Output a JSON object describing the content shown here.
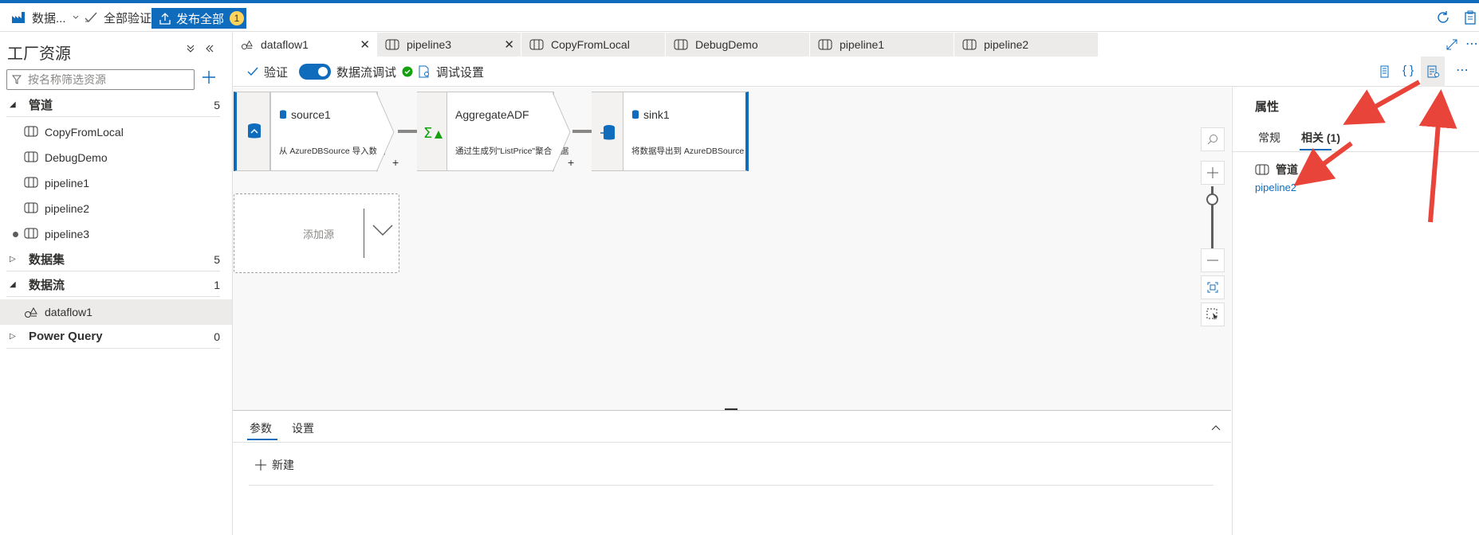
{
  "topbar": {
    "factory_label": "数据...",
    "validate_all": "全部验证",
    "publish_all": "发布全部",
    "publish_count": "1"
  },
  "sidebar": {
    "title": "工厂资源",
    "search_placeholder": "按名称筛选资源",
    "categories": [
      {
        "label": "管道",
        "count": "5"
      },
      {
        "label": "数据集",
        "count": "5"
      },
      {
        "label": "数据流",
        "count": "1"
      },
      {
        "label": "Power Query",
        "count": "0"
      }
    ],
    "pipelines": [
      "CopyFromLocal",
      "DebugDemo",
      "pipeline1",
      "pipeline2",
      "pipeline3"
    ],
    "dataflows": [
      "dataflow1"
    ]
  },
  "tabs": [
    {
      "label": "dataflow1",
      "icon": "dataflow-icon"
    },
    {
      "label": "pipeline3",
      "icon": "pipeline-icon"
    },
    {
      "label": "CopyFromLocal",
      "icon": "pipeline-icon"
    },
    {
      "label": "DebugDemo",
      "icon": "pipeline-icon"
    },
    {
      "label": "pipeline1",
      "icon": "pipeline-icon"
    },
    {
      "label": "pipeline2",
      "icon": "pipeline-icon"
    }
  ],
  "toolbar": {
    "validate": "验证",
    "debug_toggle": "数据流调试",
    "debug_settings": "调试设置"
  },
  "canvas": {
    "nodes": [
      {
        "title": "source1",
        "desc": "从 AzureDBSource 导入数据"
      },
      {
        "title": "AggregateADF",
        "desc": "通过生成列\"ListPrice\"聚合数据"
      },
      {
        "title": "sink1",
        "desc": "将数据导出到 AzureDBSource"
      }
    ],
    "add_source": "添加源"
  },
  "bottom": {
    "tab_params": "参数",
    "tab_settings": "设置",
    "new_button": "新建"
  },
  "properties": {
    "title": "属性",
    "tab_general": "常规",
    "tab_related": "相关 (1)",
    "section": "管道",
    "link": "pipeline2"
  },
  "colors": {
    "accent": "#0f6cbd",
    "badge": "#ffd45c",
    "arrow": "#e8443a"
  }
}
